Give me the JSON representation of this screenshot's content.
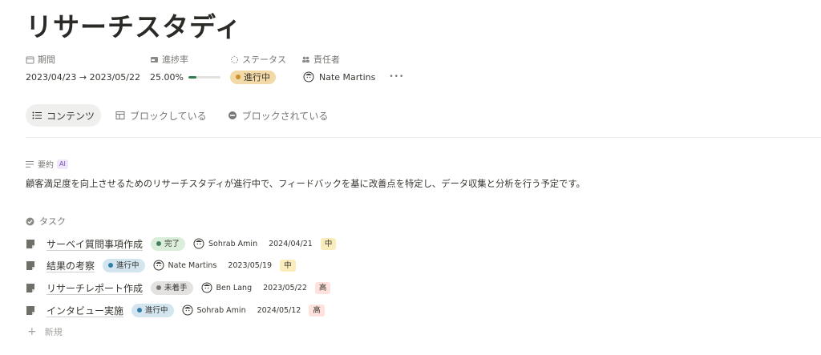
{
  "page": {
    "title": "リサーチスタディ"
  },
  "properties": {
    "period": {
      "label": "期間",
      "value": "2023/04/23 → 2023/05/22"
    },
    "progress": {
      "label": "進捗率",
      "value": "25.00%",
      "fraction": 0.25
    },
    "status": {
      "label": "ステータス",
      "value": "進行中",
      "color": "#f2d9a6",
      "dot": "#cb912f"
    },
    "owner": {
      "label": "責任者",
      "name": "Nate Martins"
    },
    "more": "•••"
  },
  "tabs": [
    {
      "label": "コンテンツ",
      "icon": "list-icon",
      "active": true
    },
    {
      "label": "ブロックしている",
      "icon": "table-icon",
      "active": false
    },
    {
      "label": "ブロックされている",
      "icon": "block-icon",
      "active": false
    }
  ],
  "summary": {
    "label": "要約",
    "ai_badge": "AI",
    "text": "顧客満足度を向上させるためのリサーチスタディが進行中で、フィードバックを基に改善点を特定し、データ収集と分析を行う予定です。"
  },
  "tasks": {
    "label": "タスク",
    "rows": [
      {
        "name": "サーベイ質問事項作成",
        "status": "完了",
        "status_bg": "#dbeddb",
        "status_dot": "#448361",
        "assignee": "Sohrab Amin",
        "date": "2024/04/21",
        "priority": "中",
        "priority_bg": "#fbecbc"
      },
      {
        "name": "結果の考察",
        "status": "進行中",
        "status_bg": "#d3e5ef",
        "status_dot": "#337ea9",
        "assignee": "Nate Martins",
        "date": "2023/05/19",
        "priority": "中",
        "priority_bg": "#fbecbc"
      },
      {
        "name": "リサーチレポート作成",
        "status": "未着手",
        "status_bg": "#e3e2e0",
        "status_dot": "#787774",
        "assignee": "Ben Lang",
        "date": "2023/05/22",
        "priority": "高",
        "priority_bg": "#ffe2dd"
      },
      {
        "name": "インタビュー実施",
        "status": "進行中",
        "status_bg": "#d3e5ef",
        "status_dot": "#337ea9",
        "assignee": "Sohrab Amin",
        "date": "2024/05/12",
        "priority": "高",
        "priority_bg": "#ffe2dd"
      }
    ],
    "new_label": "新規"
  }
}
